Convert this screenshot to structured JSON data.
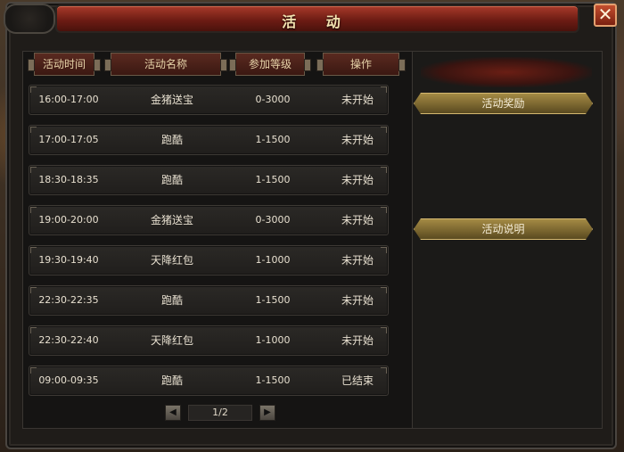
{
  "window": {
    "title": "活  动",
    "close_label": "✕"
  },
  "table": {
    "headers": [
      "活动时间",
      "活动名称",
      "参加等级",
      "操作"
    ],
    "rows": [
      {
        "time": "16:00-17:00",
        "name": "金猪送宝",
        "level": "0-3000",
        "status": "未开始"
      },
      {
        "time": "17:00-17:05",
        "name": "跑酷",
        "level": "1-1500",
        "status": "未开始"
      },
      {
        "time": "18:30-18:35",
        "name": "跑酷",
        "level": "1-1500",
        "status": "未开始"
      },
      {
        "time": "19:00-20:00",
        "name": "金猪送宝",
        "level": "0-3000",
        "status": "未开始"
      },
      {
        "time": "19:30-19:40",
        "name": "天降红包",
        "level": "1-1000",
        "status": "未开始"
      },
      {
        "time": "22:30-22:35",
        "name": "跑酷",
        "level": "1-1500",
        "status": "未开始"
      },
      {
        "time": "22:30-22:40",
        "name": "天降红包",
        "level": "1-1000",
        "status": "未开始"
      },
      {
        "time": "09:00-09:35",
        "name": "跑酷",
        "level": "1-1500",
        "status": "已结束"
      }
    ]
  },
  "pager": {
    "text": "1/2",
    "prev_icon": "◀",
    "next_icon": "▶"
  },
  "side": {
    "reward_label": "活动奖励",
    "desc_label": "活动说明"
  },
  "colors": {
    "title_red": "#8e2a1e",
    "gold_button": "#a48a44",
    "panel_dark": "#151413"
  }
}
